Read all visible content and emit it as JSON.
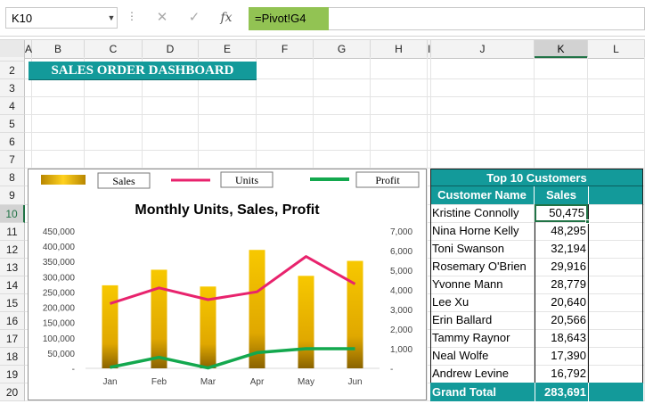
{
  "formula_bar": {
    "name_box": "K10",
    "name_box_arrow": "▼",
    "dots": "⋮",
    "cancel_glyph": "✕",
    "enter_glyph": "✓",
    "fx_glyph": "fx",
    "formula": "=Pivot!G4"
  },
  "columns": [
    "A",
    "B",
    "C",
    "D",
    "E",
    "F",
    "G",
    "H",
    "I",
    "J",
    "K",
    "L"
  ],
  "selected_column": "K",
  "rows": [
    "2",
    "3",
    "4",
    "5",
    "6",
    "7",
    "8",
    "9",
    "10",
    "11",
    "12",
    "13",
    "14",
    "15",
    "16",
    "17",
    "18",
    "19",
    "20"
  ],
  "selected_row": "10",
  "dashboard_title": "SALES ORDER DASHBOARD",
  "colors": {
    "teal": "#139a9a",
    "sales_bar": "#e9b300",
    "units_line": "#e8236d",
    "profit_line": "#13a84e",
    "selection": "#217346"
  },
  "chart_data": {
    "type": "bar",
    "title": "Monthly Units, Sales, Profit",
    "categories": [
      "Jan",
      "Feb",
      "Mar",
      "Apr",
      "May",
      "Jun"
    ],
    "legend": [
      "Sales",
      "Units",
      "Profit"
    ],
    "legend_position": "top",
    "left_axis": {
      "ticks": [
        "450,000",
        "400,000",
        "350,000",
        "300,000",
        "250,000",
        "200,000",
        "150,000",
        "100,000",
        "50,000",
        "-"
      ],
      "ylim": [
        0,
        450000
      ]
    },
    "right_axis": {
      "ticks": [
        "7,000",
        "6,000",
        "5,000",
        "4,000",
        "3,000",
        "2,000",
        "1,000",
        "-"
      ],
      "ylim": [
        0,
        7000
      ]
    },
    "series": [
      {
        "name": "Sales",
        "type": "bar",
        "axis": "left",
        "values": [
          272000,
          323000,
          268000,
          388000,
          303000,
          352000
        ]
      },
      {
        "name": "Units",
        "type": "line",
        "axis": "right",
        "values": [
          3300,
          4100,
          3500,
          3900,
          5700,
          4300
        ]
      },
      {
        "name": "Profit",
        "type": "line",
        "axis": "right",
        "values": [
          50,
          560,
          20,
          800,
          1000,
          1000
        ]
      }
    ],
    "grid": false
  },
  "top_customers": {
    "title": "Top 10 Customers",
    "header_name": "Customer Name",
    "header_sales": "Sales",
    "rows": [
      {
        "name": "Kristine Connolly",
        "sales": "50,475"
      },
      {
        "name": "Nina Horne Kelly",
        "sales": "48,295"
      },
      {
        "name": "Toni Swanson",
        "sales": "32,194"
      },
      {
        "name": "Rosemary O'Brien",
        "sales": "29,916"
      },
      {
        "name": "Yvonne Mann",
        "sales": "28,779"
      },
      {
        "name": "Lee Xu",
        "sales": "20,640"
      },
      {
        "name": "Erin Ballard",
        "sales": "20,566"
      },
      {
        "name": "Tammy Raynor",
        "sales": "18,643"
      },
      {
        "name": "Neal Wolfe",
        "sales": "17,390"
      },
      {
        "name": "Andrew Levine",
        "sales": "16,792"
      }
    ],
    "total_label": "Grand Total",
    "total_value": "283,691"
  }
}
